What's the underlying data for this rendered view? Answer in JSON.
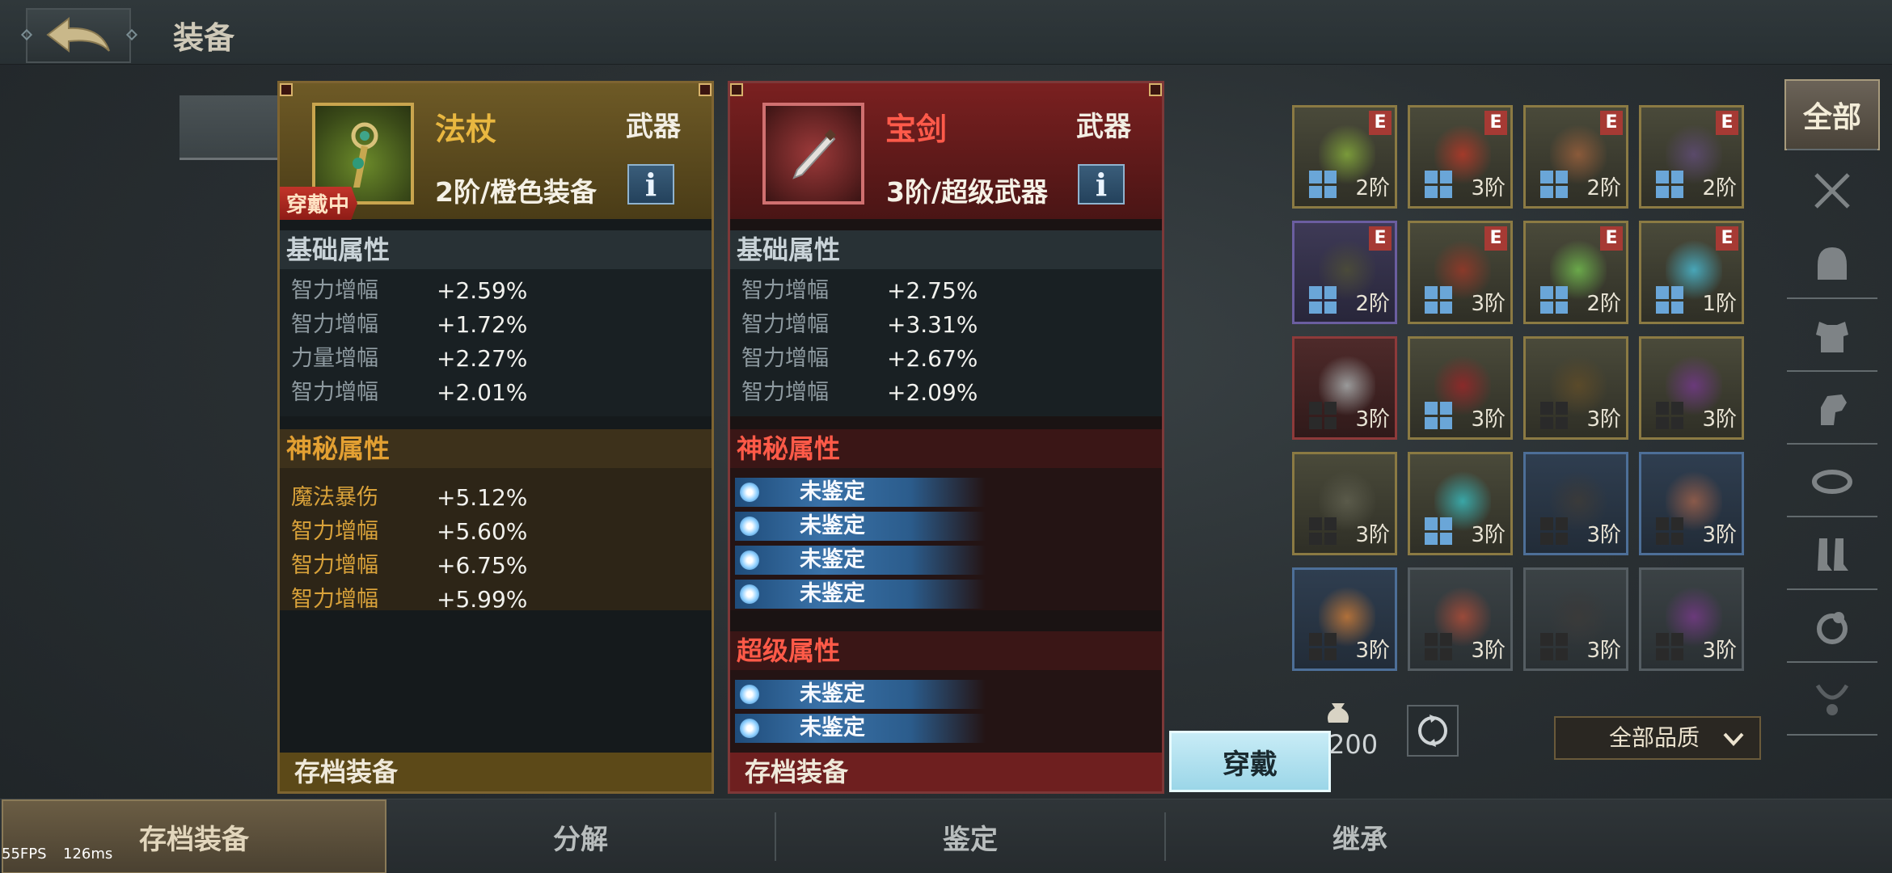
{
  "header": {
    "title": "装备"
  },
  "left_card": {
    "name": "法杖",
    "type": "武器",
    "grade": "2阶/橙色装备",
    "equipped_badge": "穿戴中",
    "info": "i",
    "basic_title": "基础属性",
    "basic_attrs": [
      {
        "k": "智力增幅",
        "v": "+2.59%"
      },
      {
        "k": "智力增幅",
        "v": "+1.72%"
      },
      {
        "k": "力量增幅",
        "v": "+2.27%"
      },
      {
        "k": "智力增幅",
        "v": "+2.01%"
      }
    ],
    "mystic_title": "神秘属性",
    "mystic_attrs": [
      {
        "k": "魔法暴伤",
        "v": "+5.12%"
      },
      {
        "k": "智力增幅",
        "v": "+5.60%"
      },
      {
        "k": "智力增幅",
        "v": "+6.75%"
      },
      {
        "k": "智力增幅",
        "v": "+5.99%"
      }
    ],
    "footer": "存档装备"
  },
  "right_card": {
    "name": "宝剑",
    "type": "武器",
    "grade": "3阶/超级武器",
    "info": "i",
    "basic_title": "基础属性",
    "basic_attrs": [
      {
        "k": "智力增幅",
        "v": "+2.75%"
      },
      {
        "k": "智力增幅",
        "v": "+3.31%"
      },
      {
        "k": "智力增幅",
        "v": "+2.67%"
      },
      {
        "k": "智力增幅",
        "v": "+2.09%"
      }
    ],
    "mystic_title": "神秘属性",
    "mystic_unidentified": [
      "未鉴定",
      "未鉴定",
      "未鉴定",
      "未鉴定"
    ],
    "super_title": "超级属性",
    "super_unidentified": [
      "未鉴定",
      "未鉴定"
    ],
    "footer": "存档装备"
  },
  "equip_button": "穿戴",
  "inventory": [
    {
      "tier": "2阶",
      "e": "E",
      "quality": "gold"
    },
    {
      "tier": "3阶",
      "e": "E",
      "quality": "gold"
    },
    {
      "tier": "2阶",
      "e": "E",
      "quality": "gold"
    },
    {
      "tier": "2阶",
      "e": "E",
      "quality": "gold"
    },
    {
      "tier": "2阶",
      "e": "E",
      "quality": "purple"
    },
    {
      "tier": "3阶",
      "e": "E",
      "quality": "gold"
    },
    {
      "tier": "2阶",
      "e": "E",
      "quality": "gold"
    },
    {
      "tier": "1阶",
      "e": "E",
      "quality": "gold"
    },
    {
      "tier": "3阶",
      "e": "",
      "quality": "red"
    },
    {
      "tier": "3阶",
      "e": "",
      "quality": "gold"
    },
    {
      "tier": "3阶",
      "e": "",
      "quality": "gold"
    },
    {
      "tier": "3阶",
      "e": "",
      "quality": "gold"
    },
    {
      "tier": "3阶",
      "e": "",
      "quality": "gold"
    },
    {
      "tier": "3阶",
      "e": "",
      "quality": "gold"
    },
    {
      "tier": "3阶",
      "e": "",
      "quality": "blue"
    },
    {
      "tier": "3阶",
      "e": "",
      "quality": "blue"
    },
    {
      "tier": "3阶",
      "e": "",
      "quality": "blue"
    },
    {
      "tier": "3阶",
      "e": "",
      "quality": "grey"
    },
    {
      "tier": "3阶",
      "e": "",
      "quality": "grey"
    },
    {
      "tier": "3阶",
      "e": "",
      "quality": "grey"
    }
  ],
  "side_tabs": {
    "all": "全部"
  },
  "coins": "200",
  "quality_filter": "全部品质",
  "bottom_tabs": [
    "存档装备",
    "分解",
    "鉴定",
    "继承"
  ],
  "debug": {
    "fps": "55FPS",
    "ms": "126ms"
  },
  "colors": {
    "gold": "#e9b740",
    "red": "#ff5a4a",
    "accent_blue": "#9bd6e8"
  }
}
